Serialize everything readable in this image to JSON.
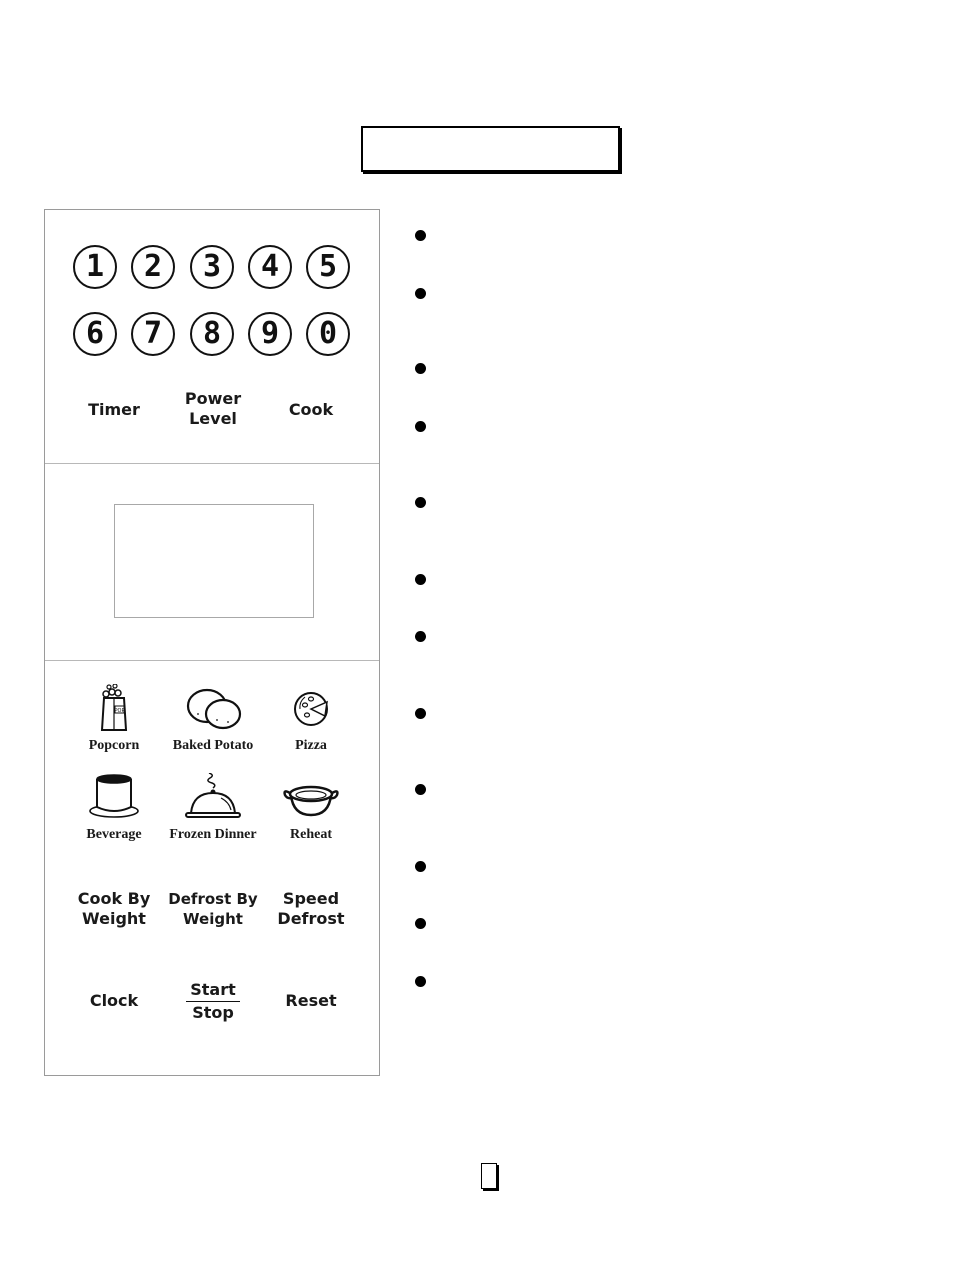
{
  "title_box": {
    "text": ""
  },
  "control_panel": {
    "number_pad": [
      "1",
      "2",
      "3",
      "4",
      "5",
      "6",
      "7",
      "8",
      "9",
      "0"
    ],
    "function_keys_top": [
      {
        "id": "timer",
        "label": "Timer"
      },
      {
        "id": "power-level",
        "label": "Power\nLevel"
      },
      {
        "id": "cook",
        "label": "Cook"
      }
    ],
    "display": {
      "text": ""
    },
    "food_keys": [
      {
        "id": "popcorn",
        "label": "Popcorn",
        "icon": "popcorn-bag-icon"
      },
      {
        "id": "baked-potato",
        "label": "Baked Potato",
        "icon": "potato-icon"
      },
      {
        "id": "pizza",
        "label": "Pizza",
        "icon": "pizza-icon"
      },
      {
        "id": "beverage",
        "label": "Beverage",
        "icon": "cup-icon"
      },
      {
        "id": "frozen-dinner",
        "label": "Frozen Dinner",
        "icon": "cloche-icon"
      },
      {
        "id": "reheat",
        "label": "Reheat",
        "icon": "pot-icon"
      }
    ],
    "function_keys_bottom": [
      {
        "id": "cook-by-weight",
        "label": "Cook By\nWeight"
      },
      {
        "id": "defrost-by-weight",
        "label": "Defrost By\nWeight"
      },
      {
        "id": "speed-defrost",
        "label": "Speed\nDefrost"
      },
      {
        "id": "clock",
        "label": "Clock"
      },
      {
        "id": "reset",
        "label": "Reset"
      }
    ],
    "start_stop": {
      "top": "Start",
      "bottom": "Stop"
    }
  },
  "bullet_list": {
    "count": 12,
    "items": [
      "",
      "",
      "",
      "",
      "",
      "",
      "",
      "",
      "",
      "",
      "",
      ""
    ]
  },
  "page_number_box": {
    "text": ""
  }
}
